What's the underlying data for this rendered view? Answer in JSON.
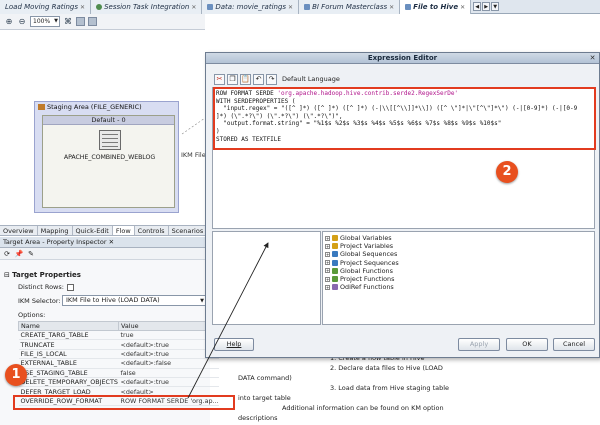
{
  "tabs": [
    {
      "label": "Load Moving Ratings",
      "active": false
    },
    {
      "label": "Session Task Integration",
      "active": false
    },
    {
      "label": "Data: movie_ratings",
      "active": false
    },
    {
      "label": "BI Forum Masterclass",
      "active": false
    },
    {
      "label": "File to Hive",
      "active": true
    }
  ],
  "canvas_toolbar": {
    "zoom": "100%"
  },
  "staging": {
    "title": "Staging Area (FILE_GENERIC)",
    "default_label": "Default - 0",
    "datastore": "APACHE_COMBINED_WEBLOG",
    "ikm_label": "IKM File"
  },
  "perspective_tabs": [
    "Overview",
    "Mapping",
    "Quick-Edit",
    "Flow",
    "Controls",
    "Scenarios"
  ],
  "inspector": {
    "header": "Target Area - Property Inspector",
    "section": "Target Properties",
    "distinct_rows": "Distinct Rows:",
    "ikm_selector_label": "IKM Selector:",
    "ikm_selector_value": "IKM File to Hive (LOAD DATA)",
    "options_label": "Options:",
    "columns": [
      "Name",
      "Value"
    ],
    "options": [
      {
        "name": "CREATE_TARG_TABLE",
        "value": "true"
      },
      {
        "name": "TRUNCATE",
        "value": "<default>:true"
      },
      {
        "name": "FILE_IS_LOCAL",
        "value": "<default>:true"
      },
      {
        "name": "EXTERNAL_TABLE",
        "value": "<default>:false"
      },
      {
        "name": "USE_STAGING_TABLE",
        "value": "false"
      },
      {
        "name": "DELETE_TEMPORARY_OBJECTS",
        "value": "<default>:true"
      },
      {
        "name": "DEFER_TARGET_LOAD",
        "value": "<default>"
      },
      {
        "name": "OVERRIDE_ROW_FORMAT",
        "value": "ROW FORMAT SERDE 'org.ap..."
      }
    ]
  },
  "dialog": {
    "title": "Expression Editor",
    "language": "Default Language",
    "code_lines": [
      {
        "pre": "ROW FORMAT SERDE ",
        "str": "'org.apache.hadoop.hive.contrib.serde2.RegexSerDe'",
        "post": ""
      },
      {
        "pre": "WITH SERDEPROPERTIES (",
        "str": "",
        "post": ""
      },
      {
        "pre": "  \"input.regex\" = \"([^ ]*) ([^ ]*) ([^ ]*) (-|\\\\[[^\\\\]]*\\\\]) ([^ \\\"]*|\\\"[^\\\"]*\\\") (-|[0-9]*) (-|[0-9",
        "str": "",
        "post": ""
      },
      {
        "pre": "]*) (\\\".*?\\\") (\\\".*?\\\") (\\\".*?\\\")\",",
        "str": "",
        "post": ""
      },
      {
        "pre": "  \"output.format.string\" = \"%1$s %2$s %3$s %4$s %5$s %6$s %7$s %8$s %9$s %10$s\"",
        "str": "",
        "post": ""
      },
      {
        "pre": ")",
        "str": "",
        "post": ""
      },
      {
        "pre": "STORED AS TEXTFILE",
        "str": "",
        "post": ""
      }
    ],
    "tree": [
      {
        "label": "Global Variables",
        "color": "#d4a017"
      },
      {
        "label": "Project Variables",
        "color": "#d4a017"
      },
      {
        "label": "Global Sequences",
        "color": "#3a7abf"
      },
      {
        "label": "Project Sequences",
        "color": "#3a7abf"
      },
      {
        "label": "Global Functions",
        "color": "#5a9a3a"
      },
      {
        "label": "Project Functions",
        "color": "#5a9a3a"
      },
      {
        "label": "OdiRef Functions",
        "color": "#8a6ab0"
      }
    ],
    "buttons": {
      "help": "Help",
      "apply": "Apply",
      "ok": "OK",
      "cancel": "Cancel"
    }
  },
  "help_text": {
    "line1": "1. Create a flow table in Hive",
    "line2": "2. Declare data files to Hive (LOAD",
    "line3": "DATA command)",
    "line4": "3. Load data from Hive staging table",
    "line5": "into target table",
    "line6": "Additional information can be found on KM option",
    "line7": "descriptions"
  },
  "callouts": {
    "one": "1",
    "two": "2"
  }
}
